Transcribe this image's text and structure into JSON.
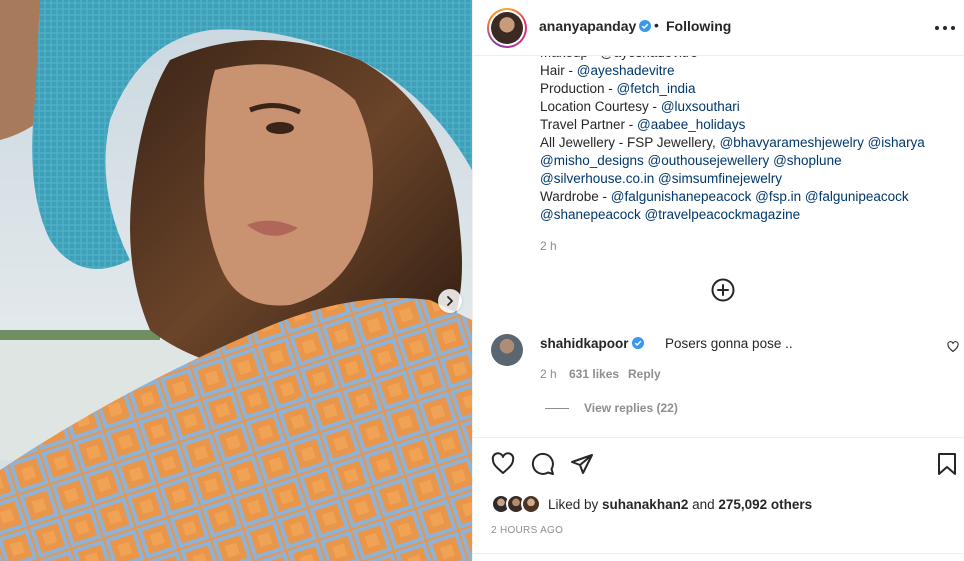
{
  "post": {
    "username": "ananyapanday",
    "separator": "•",
    "follow_status": "Following",
    "caption_partial_top": "Makeup - @ayeshadevitre",
    "caption_lines": [
      [
        {
          "t": "Hair - ",
          "m": false
        },
        {
          "t": "@ayeshadevitre",
          "m": true
        }
      ],
      [
        {
          "t": "Production - ",
          "m": false
        },
        {
          "t": "@fetch_india",
          "m": true
        }
      ],
      [
        {
          "t": "Location Courtesy - ",
          "m": false
        },
        {
          "t": "@luxsouthari",
          "m": true
        }
      ],
      [
        {
          "t": "Travel Partner - ",
          "m": false
        },
        {
          "t": "@aabee_holidays",
          "m": true
        }
      ],
      [
        {
          "t": "All Jewellery - FSP Jewellery, ",
          "m": false
        },
        {
          "t": "@bhavyarameshjewelry",
          "m": true
        },
        {
          "t": " ",
          "m": false
        },
        {
          "t": "@isharya",
          "m": true
        }
      ],
      [
        {
          "t": "@misho_designs",
          "m": true
        },
        {
          "t": " ",
          "m": false
        },
        {
          "t": "@outhousejewellery",
          "m": true
        },
        {
          "t": " ",
          "m": false
        },
        {
          "t": "@shoplune",
          "m": true
        }
      ],
      [
        {
          "t": "@silverhouse.co.in",
          "m": true
        },
        {
          "t": " ",
          "m": false
        },
        {
          "t": "@simsumfinejewelry",
          "m": true
        }
      ],
      [
        {
          "t": "Wardrobe - ",
          "m": false
        },
        {
          "t": "@falgunishanepeacock",
          "m": true
        },
        {
          "t": " ",
          "m": false
        },
        {
          "t": "@fsp.in",
          "m": true
        },
        {
          "t": " ",
          "m": false
        },
        {
          "t": "@falgunipeacock",
          "m": true
        }
      ],
      [
        {
          "t": "@shanepeacock",
          "m": true
        },
        {
          "t": " ",
          "m": false
        },
        {
          "t": "@travelpeacockmagazine",
          "m": true
        }
      ]
    ],
    "caption_time": "2 h"
  },
  "comment": {
    "username": "shahidkapoor",
    "text": "Posers gonna pose ..",
    "time": "2 h",
    "likes": "631 likes",
    "reply_label": "Reply",
    "view_replies": "View replies (22)"
  },
  "likes": {
    "prefix": "Liked by ",
    "user": "suhanakhan2",
    "middle": " and ",
    "others": "275,092 others"
  },
  "post_time": "2 HOURS AGO",
  "colors": {
    "accent_blue": "#0095f6",
    "mention_blue": "#00376b",
    "muted_gray": "#8e8e8e",
    "text": "#262626"
  },
  "icons": [
    "chevron-right-icon",
    "verified-badge-icon",
    "more-options-icon",
    "load-more-plus-icon",
    "heart-icon",
    "comment-icon",
    "share-icon",
    "bookmark-icon"
  ]
}
